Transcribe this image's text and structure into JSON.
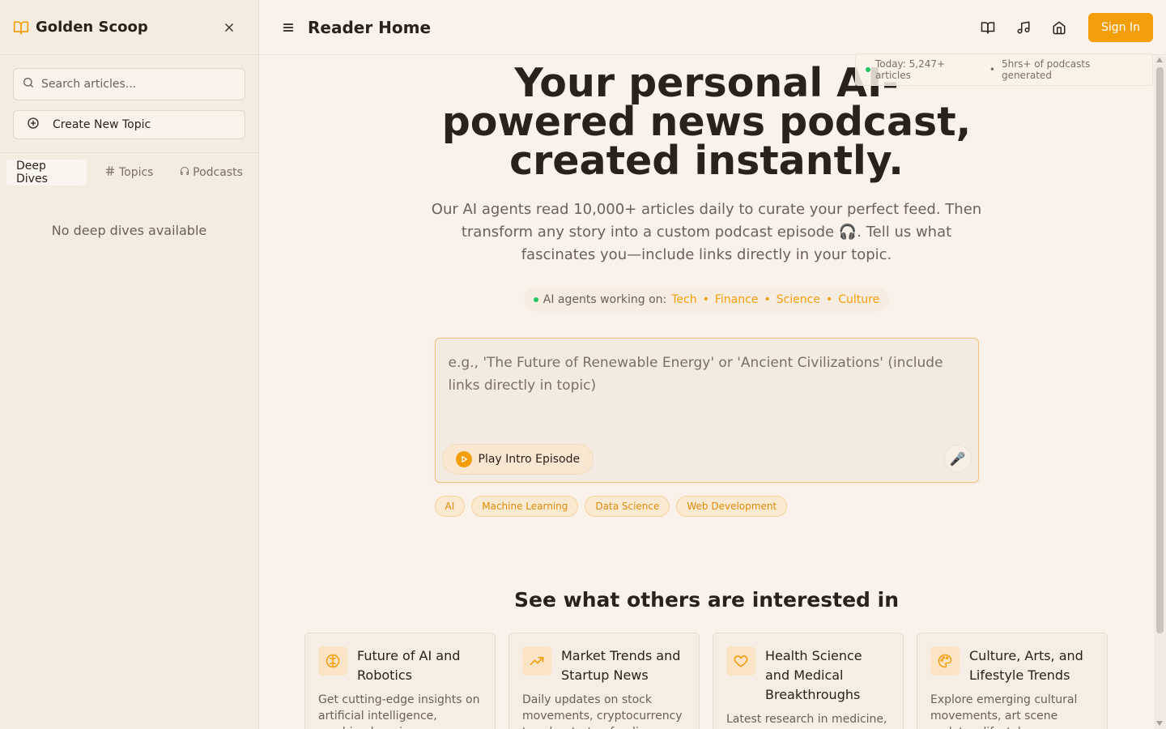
{
  "sidebar": {
    "app_name": "Golden Scoop",
    "search_placeholder": "Search articles...",
    "create_label": "Create New Topic",
    "tabs": [
      {
        "label": "Deep Dives",
        "icon": "none",
        "active": true
      },
      {
        "label": "Topics",
        "icon": "hash-icon"
      },
      {
        "label": "Podcasts",
        "icon": "headphones-icon"
      }
    ],
    "empty_text": "No deep dives available"
  },
  "topbar": {
    "title": "Reader Home",
    "icons": [
      "book-open-icon",
      "music-icon",
      "home-icon"
    ],
    "signin_label": "Sign In"
  },
  "stats": {
    "articles": "Today: 5,247+ articles",
    "sep": "•",
    "podcasts": "5hrs+ of podcasts generated"
  },
  "hero": {
    "title": "Your personal AI-powered news podcast, created instantly.",
    "subtitle": "Our AI agents read 10,000+ articles daily to curate your perfect feed. Then transform any story into a custom podcast episode 🎧. Tell us what fascinates you—include links directly in your topic."
  },
  "agents": {
    "label": "AI agents working on:",
    "categories": [
      "Tech",
      "Finance",
      "Science",
      "Culture"
    ],
    "sep": "•"
  },
  "prompt": {
    "placeholder": "e.g., 'The Future of Renewable Energy' or 'Ancient Civilizations' (include links directly in topic)",
    "play_label": "Play Intro Episode",
    "mic_glyph": "🎤"
  },
  "chips": [
    "AI",
    "Machine Learning",
    "Data Science",
    "Web Development"
  ],
  "interests": {
    "title": "See what others are interested in",
    "cards": [
      {
        "icon": "brain-icon",
        "title": "Future of AI and Robotics",
        "desc": "Get cutting-edge insights on artificial intelligence, machine learning..."
      },
      {
        "icon": "trending-up-icon",
        "title": "Market Trends and Startup News",
        "desc": "Daily updates on stock movements, cryptocurrency trends, startup funding..."
      },
      {
        "icon": "heart-icon",
        "title": "Health Science and Medical Breakthroughs",
        "desc": "Latest research in medicine, nutrition studies, mental..."
      },
      {
        "icon": "palette-icon",
        "title": "Culture, Arts, and Lifestyle Trends",
        "desc": "Explore emerging cultural movements, art scene updates, lifestyle..."
      }
    ]
  },
  "colors": {
    "accent": "#f59e0b",
    "status_dot": "#22c55e",
    "background": "#faf2ea"
  }
}
